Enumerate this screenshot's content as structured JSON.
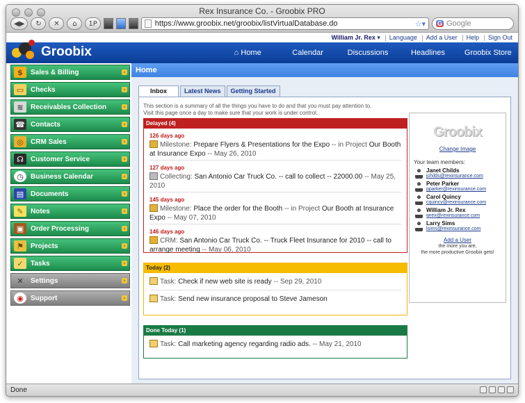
{
  "browser": {
    "window_title": "Rex Insurance Co. - Groobix PRO",
    "url": "https://www.groobix.net/groobix/listVirtualDatabase.do",
    "search_placeholder": "Google",
    "status": "Done",
    "tb_1p": "1P"
  },
  "topnav": {
    "user": "William Jr. Rex",
    "language": "Language",
    "add_user": "Add a User",
    "help": "Help",
    "sign_out": "Sign Out"
  },
  "app": {
    "name": "Groobix",
    "nav": [
      "Home",
      "Calendar",
      "Discussions",
      "Headlines",
      "Groobix Store"
    ]
  },
  "sidebar": {
    "items": [
      {
        "label": "Sales & Billing",
        "icon": "dollar-icon"
      },
      {
        "label": "Checks",
        "icon": "check-icon"
      },
      {
        "label": "Receivables Collection",
        "icon": "money-icon"
      },
      {
        "label": "Contacts",
        "icon": "phone-icon"
      },
      {
        "label": "CRM Sales",
        "icon": "coins-icon"
      },
      {
        "label": "Customer Service",
        "icon": "headset-icon"
      },
      {
        "label": "Business Calendar",
        "icon": "clock-icon"
      },
      {
        "label": "Documents",
        "icon": "documents-icon"
      },
      {
        "label": "Notes",
        "icon": "notes-icon"
      },
      {
        "label": "Order Processing",
        "icon": "box-icon"
      },
      {
        "label": "Projects",
        "icon": "projects-icon"
      },
      {
        "label": "Tasks",
        "icon": "tasks-icon"
      },
      {
        "label": "Settings",
        "icon": "tools-icon"
      },
      {
        "label": "Support",
        "icon": "lifebuoy-icon"
      }
    ]
  },
  "main": {
    "title": "Home",
    "tabs": [
      "Inbox",
      "Latest News",
      "Getting Started"
    ],
    "intro_line1": "This section is a summary of all the things you have to do and that you must pay attention to.",
    "intro_line2": "Visit this page once a day to make sure that your work is under control.",
    "delayed": {
      "header": "Delayed (4)",
      "items": [
        {
          "age": "126 days ago",
          "type": "Milestone:",
          "text": "Prepare Flyers & Presentations for the Expo",
          "mid": " -- in Project ",
          "project": "Our Booth at Insurance Expo",
          "date": " -- May 26, 2010"
        },
        {
          "age": "127 days ago",
          "type": "Collecting:",
          "text": "San Antonio Car Truck Co. -- call to collect -- 22000.00",
          "mid": "",
          "project": "",
          "date": " -- May 25, 2010"
        },
        {
          "age": "145 days ago",
          "type": "Milestone:",
          "text": "Place the order for the Booth",
          "mid": " -- in Project ",
          "project": "Our Booth at Insurance Expo",
          "date": " -- May 07, 2010"
        },
        {
          "age": "146 days ago",
          "type": "CRM:",
          "text": "San Antonio Car Truck Co. -- Truck Fleet Insurance for 2010 -- call to arrange meeting",
          "mid": "",
          "project": "",
          "date": " -- May 06, 2010"
        }
      ]
    },
    "today": {
      "header": "Today (2)",
      "items": [
        {
          "type": "Task:",
          "text": "Check if new web site is ready",
          "date": " -- Sep 29, 2010"
        },
        {
          "type": "Task:",
          "text": "Send new insurance proposal to Steve Jameson",
          "date": ""
        }
      ]
    },
    "done_today": {
      "header": "Done Today (1)",
      "items": [
        {
          "type": "Task:",
          "text": "Call marketing agency regarding radio ads.",
          "date": " -- May 21, 2010"
        }
      ]
    }
  },
  "team": {
    "logo": "Groobix",
    "change_image": "Change Image",
    "label": "Your team members:",
    "members": [
      {
        "name": "Janet Childs",
        "email": "jchilds@rexinsurance.com"
      },
      {
        "name": "Peter Parker",
        "email": "pparker@rexinsurance.com"
      },
      {
        "name": "Carol Quincy",
        "email": "cquincy@rexinsurance.com"
      },
      {
        "name": "William Jr. Rex",
        "email": "wrex@rexinsurance.com"
      },
      {
        "name": "Larry Sims",
        "email": "lsims@rexinsurance.com"
      }
    ],
    "add_user": "Add a User",
    "motto_line1": "the more you are,",
    "motto_line2": "the more productive Groobix gets!"
  },
  "colors": {
    "brand_blue": "#0b3c95",
    "sidebar_green": "#1c8b4b",
    "delayed_red": "#c02020",
    "today_yellow": "#f5bc00",
    "done_green": "#1a7a46"
  }
}
